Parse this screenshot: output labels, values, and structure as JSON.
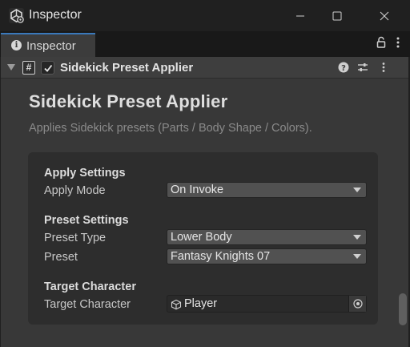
{
  "window": {
    "title": "Inspector",
    "controls": [
      "minimize-icon",
      "maximize-icon",
      "close-icon"
    ]
  },
  "tab": {
    "label": "Inspector",
    "icon": "info-icon",
    "tools": [
      "lock-icon",
      "more-vertical-icon"
    ]
  },
  "component": {
    "title": "Sidekick Preset Applier",
    "enabled": true,
    "icons": [
      "foldout-arrow-icon",
      "script-hash-icon",
      "checkbox-icon",
      "help-icon",
      "preset-sliders-icon",
      "more-vertical-icon"
    ]
  },
  "header": {
    "title": "Sidekick Preset Applier",
    "description": "Applies Sidekick presets (Parts / Body Shape / Colors)."
  },
  "sections": {
    "apply": {
      "label": "Apply Settings",
      "mode_label": "Apply Mode",
      "mode_value": "On Invoke"
    },
    "preset": {
      "label": "Preset Settings",
      "type_label": "Preset Type",
      "type_value": "Lower Body",
      "preset_label": "Preset",
      "preset_value": "Fantasy Knights 07"
    },
    "target": {
      "label": "Target Character",
      "field_label": "Target Character",
      "field_value": "Player",
      "field_icon": "gameobject-cube-icon",
      "picker_icon": "object-picker-icon"
    }
  },
  "colors": {
    "accent": "#3a79bb",
    "background": "#383838",
    "panel": "#2d2d2d"
  }
}
